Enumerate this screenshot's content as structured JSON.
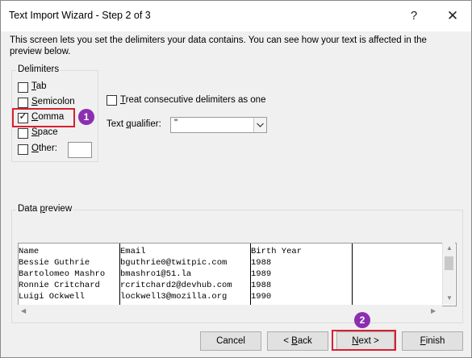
{
  "window": {
    "title": "Text Import Wizard - Step 2 of 3",
    "help_glyph": "?",
    "close_glyph": "✕"
  },
  "description": "This screen lets you set the delimiters your data contains.  You can see how your text is affected in the preview below.",
  "delimiters": {
    "group_label": "Delimiters",
    "items": [
      {
        "label": "Tab",
        "checked": false
      },
      {
        "label": "Semicolon",
        "checked": false
      },
      {
        "label": "Comma",
        "checked": true
      },
      {
        "label": "Space",
        "checked": false
      },
      {
        "label": "Other:",
        "checked": false
      }
    ],
    "other_value": ""
  },
  "consecutive": {
    "label": "Treat consecutive delimiters as one",
    "checked": false
  },
  "qualifier": {
    "label": "Text qualifier:",
    "value": "\""
  },
  "preview": {
    "group_label": "Data preview",
    "columns": [
      "Name",
      "Email",
      "Birth Year"
    ],
    "rows": [
      [
        "Bessie Guthrie",
        "bguthrie0@twitpic.com",
        "1988"
      ],
      [
        "Bartolomeo Mashro",
        "bmashro1@51.la",
        "1989"
      ],
      [
        "Ronnie Critchard",
        "rcritchard2@devhub.com",
        "1988"
      ],
      [
        "Luigi Ockwell",
        "lockwell3@mozilla.org",
        "1990"
      ]
    ]
  },
  "annotations": {
    "step1": "1",
    "step2": "2"
  },
  "buttons": {
    "cancel": "Cancel",
    "back": "< Back",
    "next": "Next >",
    "finish": "Finish"
  },
  "colors": {
    "highlight": "#d8202f",
    "badge": "#8b2fb0"
  }
}
